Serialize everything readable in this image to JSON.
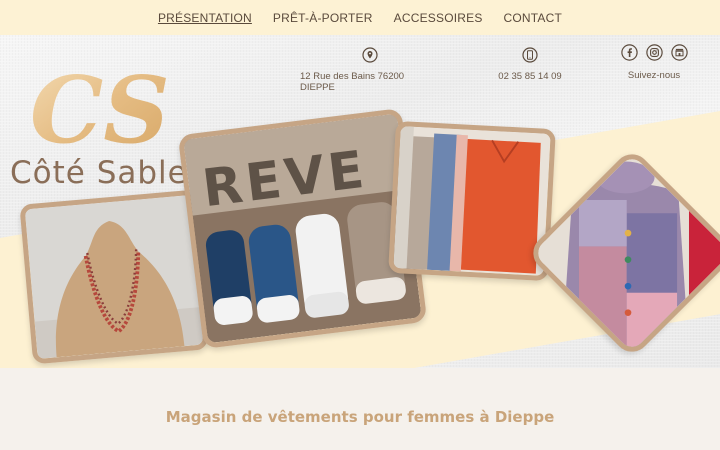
{
  "nav": {
    "items": [
      {
        "label": "PRÉSENTATION",
        "active": true
      },
      {
        "label": "PRÊT-À-PORTER",
        "active": false
      },
      {
        "label": "ACCESSOIRES",
        "active": false
      },
      {
        "label": "CONTACT",
        "active": false
      }
    ]
  },
  "brand": {
    "monogram": "CS",
    "name": "Côté Sable"
  },
  "contact": {
    "address": "12 Rue des Bains 76200 DIEPPE",
    "address_icon": "location-pin-icon",
    "phone": "02 35 85 14 09",
    "phone_icon": "mobile-phone-icon"
  },
  "social": {
    "label": "Suivez-nous",
    "icons": [
      "facebook-icon",
      "instagram-icon",
      "storefront-icon"
    ]
  },
  "gallery": {
    "photos": [
      {
        "subject": "necklace on display bust"
      },
      {
        "subject": "canvas sneakers in front of letters"
      },
      {
        "subject": "knit sweaters on hangers"
      },
      {
        "subject": "patchwork cardigan on mannequin"
      }
    ],
    "sign_text": "REVE"
  },
  "main": {
    "tagline": "Magasin de vêtements pour femmes à Dieppe"
  },
  "colors": {
    "nav_bg": "#fdf2d4",
    "frame": "#c6a585",
    "brand_text": "#8a6e58",
    "tagline": "#c9a47a",
    "monogram_gold": "#e8c38f"
  }
}
